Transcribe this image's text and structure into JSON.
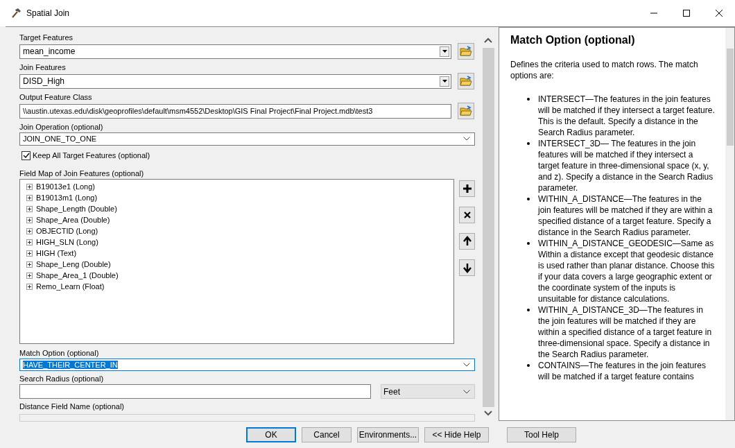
{
  "window": {
    "title": "Spatial Join"
  },
  "form": {
    "target_features": {
      "label": "Target Features",
      "value": "mean_income"
    },
    "join_features": {
      "label": "Join Features",
      "value": "DISD_High"
    },
    "output_feature_class": {
      "label": "Output Feature Class",
      "value": "\\\\austin.utexas.edu\\disk\\geoprofiles\\default\\msm4552\\Desktop\\GIS Final Project\\Final Project.mdb\\test3"
    },
    "join_operation": {
      "label": "Join Operation (optional)",
      "value": "JOIN_ONE_TO_ONE"
    },
    "keep_all": {
      "label": "Keep All Target Features (optional)",
      "checked": true
    },
    "field_map": {
      "label": "Field Map of Join Features (optional)",
      "items": [
        {
          "label": "B19013e1 (Long)",
          "expanded": false
        },
        {
          "label": "B19013m1 (Long)",
          "expanded": false
        },
        {
          "label": "Shape_Length (Double)",
          "expanded": false
        },
        {
          "label": "Shape_Area (Double)",
          "expanded": false
        },
        {
          "label": "OBJECTID (Long)",
          "expanded": false
        },
        {
          "label": "HIGH_SLN (Long)",
          "expanded": false
        },
        {
          "label": "HIGH (Text)",
          "expanded": false
        },
        {
          "label": "Shape_Leng (Double)",
          "expanded": false
        },
        {
          "label": "Shape_Area_1 (Double)",
          "expanded": false
        },
        {
          "label": "Remo_Learn (Float)",
          "expanded": false
        }
      ]
    },
    "match_option": {
      "label": "Match Option (optional)",
      "value": "HAVE_THEIR_CENTER_IN",
      "highlighted": true
    },
    "search_radius": {
      "label": "Search Radius (optional)",
      "unit": "Feet"
    },
    "distance_field": {
      "label": "Distance Field Name (optional)",
      "disabled": true
    }
  },
  "buttons": [
    {
      "label": "OK",
      "default": true
    },
    {
      "label": "Cancel",
      "default": false
    },
    {
      "label": "Environments...",
      "default": false
    },
    {
      "label": "<< Hide Help",
      "default": false
    },
    {
      "label": "Tool Help",
      "default": false
    }
  ],
  "help": {
    "title": "Match Option (optional)",
    "intro": "Defines the criteria used to match rows. The match options are:",
    "items": [
      "INTERSECT—The features in the join features will be matched if they intersect a target feature. This is the default. Specify a distance in the Search Radius parameter.",
      "INTERSECT_3D— The features in the join features will be matched if they intersect a target feature in three-dimensional space (x, y, and z). Specify a distance in the Search Radius parameter.",
      "WITHIN_A_DISTANCE—The features in the join features will be matched if they are within a specified distance of a target feature. Specify a distance in the Search Radius parameter.",
      "WITHIN_A_DISTANCE_GEODESIC—Same as Within a distance except that geodesic distance is used rather than planar distance. Choose this if your data covers a large geographic extent or the coordinate system of the inputs is unsuitable for distance calculations.",
      "WITHIN_A_DISTANCE_3D—The features in the join features will be matched if they are within a specified distance of a target feature in three-dimensional space. Specify a distance in the Search Radius parameter.",
      "CONTAINS—The features in the join features will be matched if a target feature contains"
    ]
  }
}
